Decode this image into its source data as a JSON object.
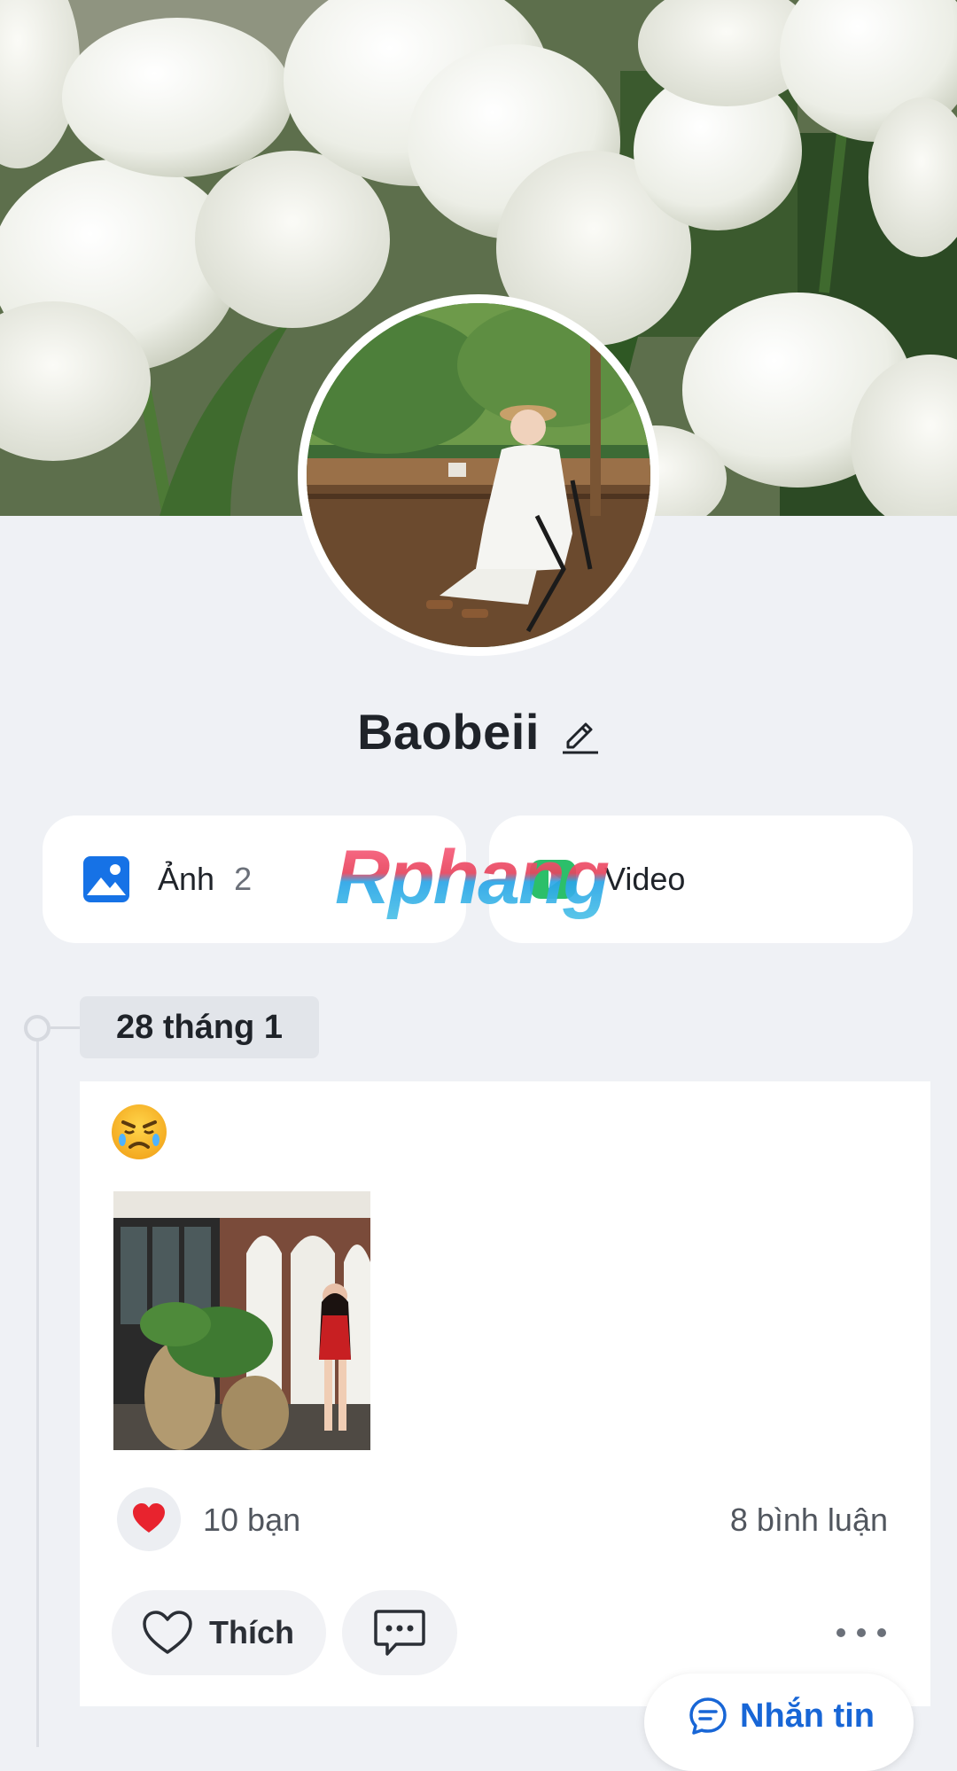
{
  "profile": {
    "name": "Baobeii"
  },
  "media_tiles": {
    "photos_label": "Ảnh",
    "photos_count": "2",
    "videos_label": "Video"
  },
  "watermark": "Rphang",
  "timeline": {
    "date": "28 tháng 1"
  },
  "post": {
    "reaction_text": "10 bạn",
    "comment_count": "8 bình luận",
    "like_label": "Thích"
  },
  "message_button": {
    "label": "Nhắn tin"
  },
  "colors": {
    "background": "#eff1f5",
    "accent_blue": "#1866d6",
    "photo_icon_blue": "#1672e6",
    "heart_red": "#e8232e"
  },
  "icons": [
    "edit-pencil-icon",
    "photo-icon",
    "video-icon",
    "crying-angry-emoji",
    "heart-icon",
    "heart-outline-icon",
    "comment-bubble-icon",
    "more-dots-icon",
    "chat-icon"
  ]
}
